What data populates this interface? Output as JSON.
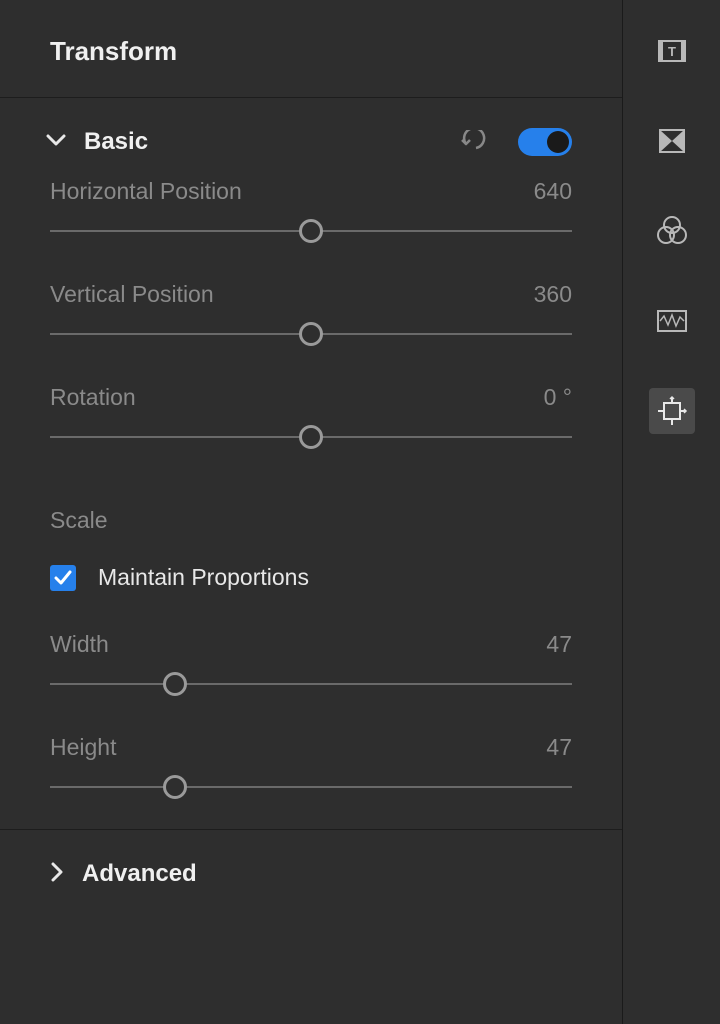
{
  "panel": {
    "title": "Transform"
  },
  "basic": {
    "title": "Basic",
    "enabled": true,
    "controls": {
      "horizontal_position": {
        "label": "Horizontal Position",
        "value": "640",
        "pct": 50
      },
      "vertical_position": {
        "label": "Vertical Position",
        "value": "360",
        "pct": 50
      },
      "rotation": {
        "label": "Rotation",
        "value": "0 °",
        "pct": 50
      }
    },
    "scale": {
      "heading": "Scale",
      "maintain_proportions_label": "Maintain Proportions",
      "maintain_proportions": true,
      "width": {
        "label": "Width",
        "value": "47",
        "pct": 24
      },
      "height": {
        "label": "Height",
        "value": "47",
        "pct": 24
      }
    }
  },
  "advanced": {
    "title": "Advanced"
  },
  "sidebar": {
    "items": [
      {
        "name": "titles-icon"
      },
      {
        "name": "transitions-icon"
      },
      {
        "name": "color-icon"
      },
      {
        "name": "audio-icon"
      },
      {
        "name": "transform-icon"
      }
    ],
    "active_index": 4
  },
  "colors": {
    "accent": "#2680eb"
  }
}
